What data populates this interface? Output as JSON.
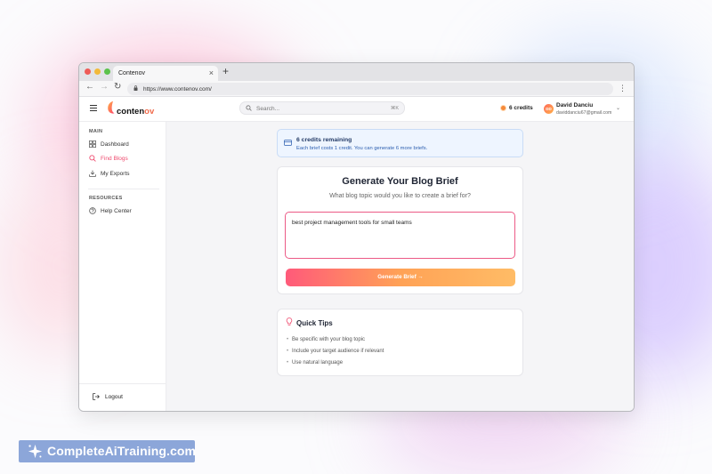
{
  "browser": {
    "tab_title": "Contenov",
    "tab_close": "×",
    "new_tab": "+",
    "back": "←",
    "forward": "→",
    "reload": "↻",
    "url": "https://www.contenov.com/",
    "menu": "⋮"
  },
  "header": {
    "logo_prefix": "conten",
    "logo_suffix": "ov",
    "search_placeholder": "Search...",
    "search_shortcut": "⌘K",
    "credits_label": "6 credits",
    "user_initials": "DD",
    "user_name": "David Danciu",
    "user_email": "daviddanciu67@gmail.com",
    "user_chevron": "⌄"
  },
  "sidebar": {
    "main_heading": "MAIN",
    "items": [
      {
        "label": "Dashboard",
        "icon": "dashboard-icon"
      },
      {
        "label": "Find Blogs",
        "icon": "search-icon",
        "active": true
      },
      {
        "label": "My Exports",
        "icon": "download-icon"
      }
    ],
    "resources_heading": "RESOURCES",
    "resources": [
      {
        "label": "Help Center",
        "icon": "help-icon"
      }
    ],
    "logout_label": "Logout"
  },
  "banner": {
    "title": "6 credits remaining",
    "subtitle": "Each brief costs 1 credit. You can generate 6 more briefs."
  },
  "brief": {
    "title": "Generate Your Blog Brief",
    "subtitle": "What blog topic would you like to create a brief for?",
    "input_value": "best project management tools for small teams",
    "button_label": "Generate Brief  →"
  },
  "tips": {
    "title": "Quick Tips",
    "items": [
      "Be specific with your blog topic",
      "Include your target audience if relevant",
      "Use natural language"
    ]
  },
  "watermark": {
    "text": "CompleteAiTraining.com"
  },
  "colors": {
    "accent": "#ef4a6e",
    "button_start": "#ff5a7a",
    "button_end": "#ffbc66",
    "banner_bg": "#eef5ff"
  }
}
